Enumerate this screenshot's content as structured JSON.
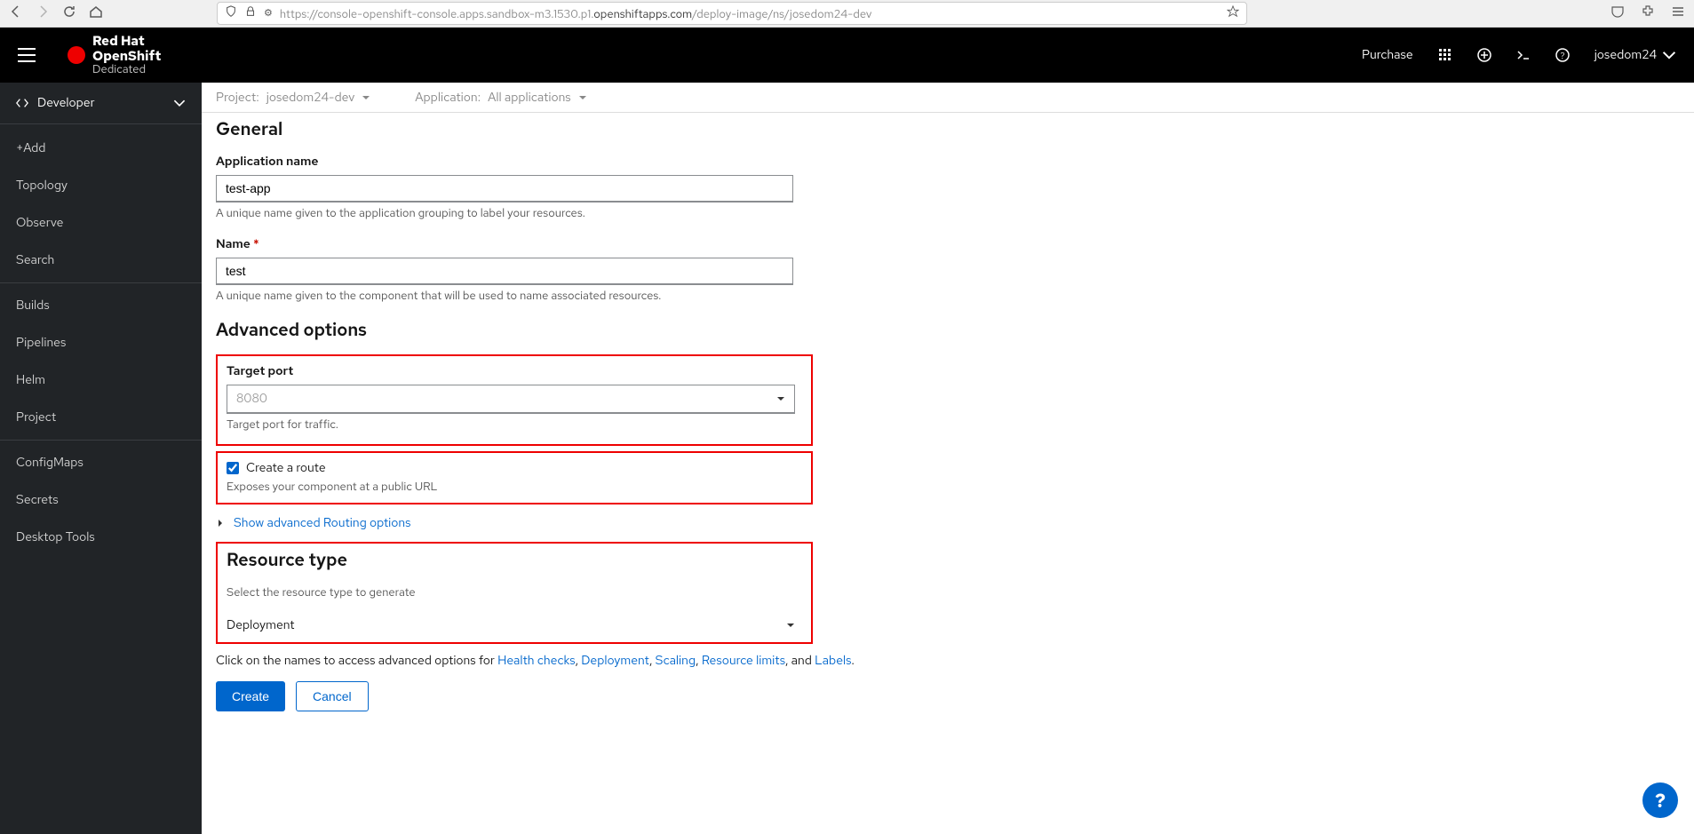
{
  "browser": {
    "url_prefix": "https://console-openshift-console.apps.sandbox-m3.1530.p1.",
    "url_bold": "openshiftapps.com",
    "url_suffix": "/deploy-image/ns/josedom24-dev"
  },
  "masthead": {
    "brand_l1": "Red Hat",
    "brand_l2": "OpenShift",
    "brand_l3": "Dedicated",
    "purchase": "Purchase",
    "user": "josedom24"
  },
  "sidebar": {
    "perspective": "Developer",
    "items": [
      "+Add",
      "Topology",
      "Observe",
      "Search",
      "Builds",
      "Pipelines",
      "Helm",
      "Project",
      "ConfigMaps",
      "Secrets",
      "Desktop Tools"
    ]
  },
  "toolbar": {
    "project_label": "Project:",
    "project_value": "josedom24-dev",
    "app_label": "Application:",
    "app_value": "All applications"
  },
  "form": {
    "general_heading": "General",
    "app_name_label": "Application name",
    "app_name_value": "test-app",
    "app_name_help": "A unique name given to the application grouping to label your resources.",
    "name_label": "Name",
    "name_value": "test",
    "name_help": "A unique name given to the component that will be used to name associated resources.",
    "advanced_heading": "Advanced options",
    "target_port_label": "Target port",
    "target_port_placeholder": "8080",
    "target_port_help": "Target port for traffic.",
    "create_route_label": "Create a route",
    "create_route_help": "Exposes your component at a public URL",
    "routing_link": "Show advanced Routing options",
    "resource_heading": "Resource type",
    "resource_sub": "Select the resource type to generate",
    "resource_value": "Deployment",
    "footer_prefix": "Click on the names to access advanced options for ",
    "links": {
      "health": "Health checks",
      "deploy": "Deployment",
      "scaling": "Scaling",
      "limits": "Resource limits",
      "labels": "Labels"
    },
    "create_btn": "Create",
    "cancel_btn": "Cancel"
  }
}
